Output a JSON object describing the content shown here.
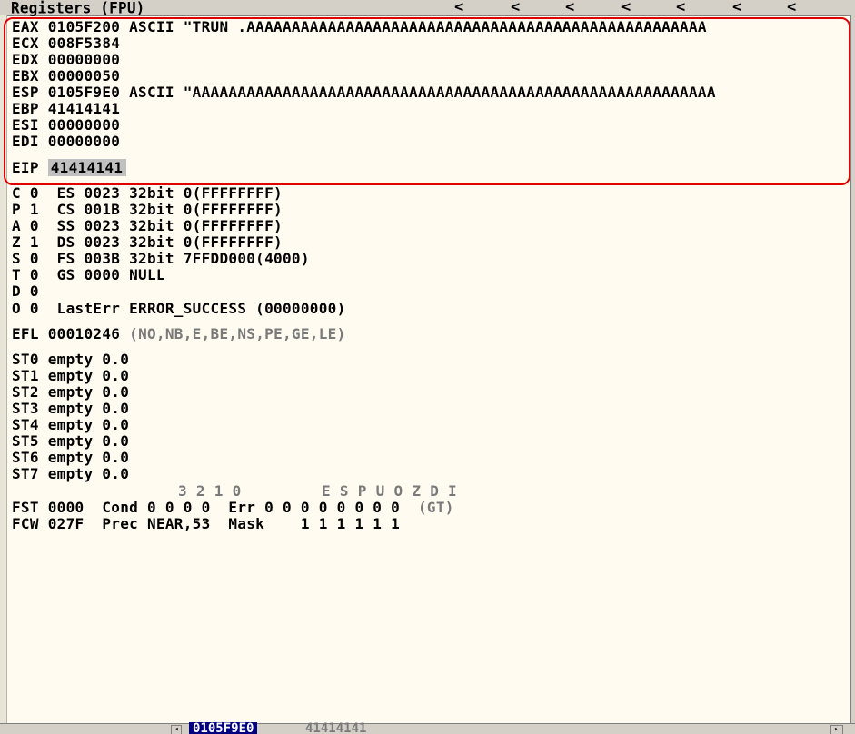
{
  "window": {
    "title": "Registers (FPU)",
    "nav_chevrons": [
      "<",
      "<",
      "<",
      "<",
      "<",
      "<",
      "<"
    ]
  },
  "registers": {
    "eax": "EAX 0105F200 ASCII \"TRUN .AAAAAAAAAAAAAAAAAAAAAAAAAAAAAAAAAAAAAAAAAAAAAAAAAAA",
    "ecx": "ECX 008F5384",
    "edx": "EDX 00000000",
    "ebx": "EBX 00000050",
    "esp": "ESP 0105F9E0 ASCII \"AAAAAAAAAAAAAAAAAAAAAAAAAAAAAAAAAAAAAAAAAAAAAAAAAAAAAAAAAA",
    "ebp": "EBP 41414141",
    "esi": "ESI 00000000",
    "edi": "EDI 00000000",
    "eip_label": "EIP",
    "eip_value": "41414141"
  },
  "flags": {
    "c": "C 0  ES 0023 32bit 0(FFFFFFFF)",
    "p": "P 1  CS 001B 32bit 0(FFFFFFFF)",
    "a": "A 0  SS 0023 32bit 0(FFFFFFFF)",
    "z": "Z 1  DS 0023 32bit 0(FFFFFFFF)",
    "s": "S 0  FS 003B 32bit 7FFDD000(4000)",
    "t": "T 0  GS 0000 NULL",
    "d": "D 0",
    "o": "O 0  LastErr ERROR_SUCCESS (00000000)"
  },
  "efl": {
    "label": "EFL 00010246",
    "decoded": "(NO,NB,E,BE,NS,PE,GE,LE)"
  },
  "fpu_stack": [
    "ST0 empty 0.0",
    "ST1 empty 0.0",
    "ST2 empty 0.0",
    "ST3 empty 0.0",
    "ST4 empty 0.0",
    "ST5 empty 0.0",
    "ST6 empty 0.0",
    "ST7 empty 0.0"
  ],
  "fpu_status": {
    "cond_header": "3 2 1 0",
    "err_header": "E S P U O Z D I",
    "fst": "FST 0000  Cond 0 0 0 0  Err 0 0 0 0 0 0 0 0",
    "fst_flag": "(GT)",
    "fcw": "FCW 027F  Prec NEAR,53  Mask    1 1 1 1 1 1"
  },
  "statusbar": {
    "stack_address": "0105F9E0",
    "stack_value": "41414141"
  },
  "colors": {
    "background": "#fffbf0",
    "highlight_border": "#e00000",
    "eip_highlight": "#c0c0c0",
    "gray_text": "#7a7a7a"
  }
}
